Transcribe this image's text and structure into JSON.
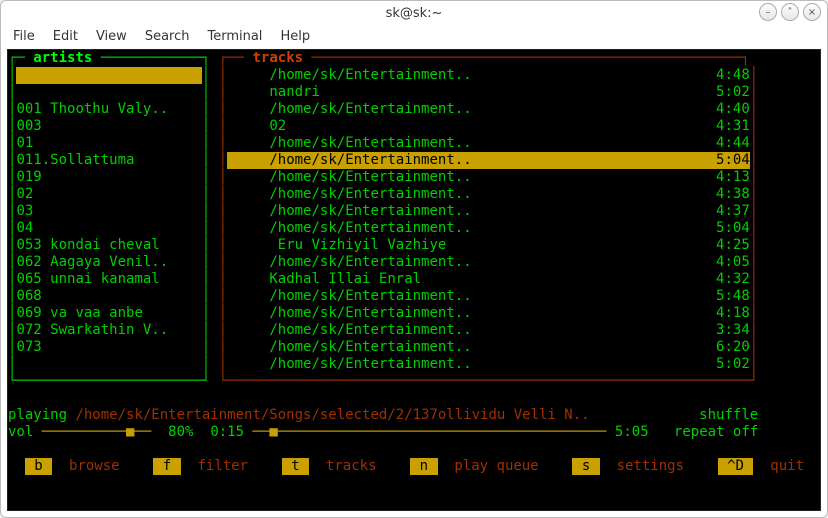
{
  "window": {
    "title": "sk@sk:~"
  },
  "menubar": [
    "File",
    "Edit",
    "View",
    "Search",
    "Terminal",
    "Help"
  ],
  "panels": {
    "artists": {
      "title": "artists",
      "selected_index": 0,
      "items": [
        "",
        "",
        "001 Thoothu Valy..",
        "003",
        "01",
        "011.Sollattuma",
        "019",
        "02",
        "03",
        "04",
        "053 kondai cheval",
        "062 Aagaya Venil..",
        "065 unnai kanamal",
        "068",
        "069 va vaa anbe",
        "072 Swarkathin V..",
        "073"
      ]
    },
    "tracks": {
      "title": "tracks",
      "selected_index": 5,
      "items": [
        {
          "title": "/home/sk/Entertainment..",
          "dur": "4:48"
        },
        {
          "title": "nandri",
          "dur": "5:02"
        },
        {
          "title": "/home/sk/Entertainment..",
          "dur": "4:40"
        },
        {
          "title": "02",
          "dur": "4:31"
        },
        {
          "title": "/home/sk/Entertainment..",
          "dur": "4:44"
        },
        {
          "title": "/home/sk/Entertainment..",
          "dur": "5:04"
        },
        {
          "title": "/home/sk/Entertainment..",
          "dur": "4:13"
        },
        {
          "title": "/home/sk/Entertainment..",
          "dur": "4:38"
        },
        {
          "title": "/home/sk/Entertainment..",
          "dur": "4:37"
        },
        {
          "title": "/home/sk/Entertainment..",
          "dur": "5:04"
        },
        {
          "title": " Eru Vizhiyil Vazhiye",
          "dur": "4:25"
        },
        {
          "title": "/home/sk/Entertainment..",
          "dur": "4:05"
        },
        {
          "title": "Kadhal Illai Enral",
          "dur": "4:32"
        },
        {
          "title": "/home/sk/Entertainment..",
          "dur": "5:48"
        },
        {
          "title": "/home/sk/Entertainment..",
          "dur": "4:18"
        },
        {
          "title": "/home/sk/Entertainment..",
          "dur": "3:34"
        },
        {
          "title": "/home/sk/Entertainment..",
          "dur": "6:20"
        },
        {
          "title": "/home/sk/Entertainment..",
          "dur": "5:02"
        }
      ]
    }
  },
  "status": {
    "state": "playing",
    "now_playing": "/home/sk/Entertainment/Songs/selected/2/137ollividu Velli N..",
    "shuffle_label": "shuffle",
    "vol_label": "vol",
    "vol_pct": "80%",
    "elapsed": "0:15",
    "total": "5:05",
    "repeat_label": "repeat off"
  },
  "hotkeys": [
    {
      "key": "b",
      "label": "browse"
    },
    {
      "key": "f",
      "label": "filter"
    },
    {
      "key": "t",
      "label": "tracks"
    },
    {
      "key": "n",
      "label": "play queue"
    },
    {
      "key": "s",
      "label": "settings"
    },
    {
      "key": "^D",
      "label": "quit"
    }
  ],
  "style": {
    "accent": "#c8a000",
    "green": "#00d000",
    "brown": "#a03000"
  }
}
